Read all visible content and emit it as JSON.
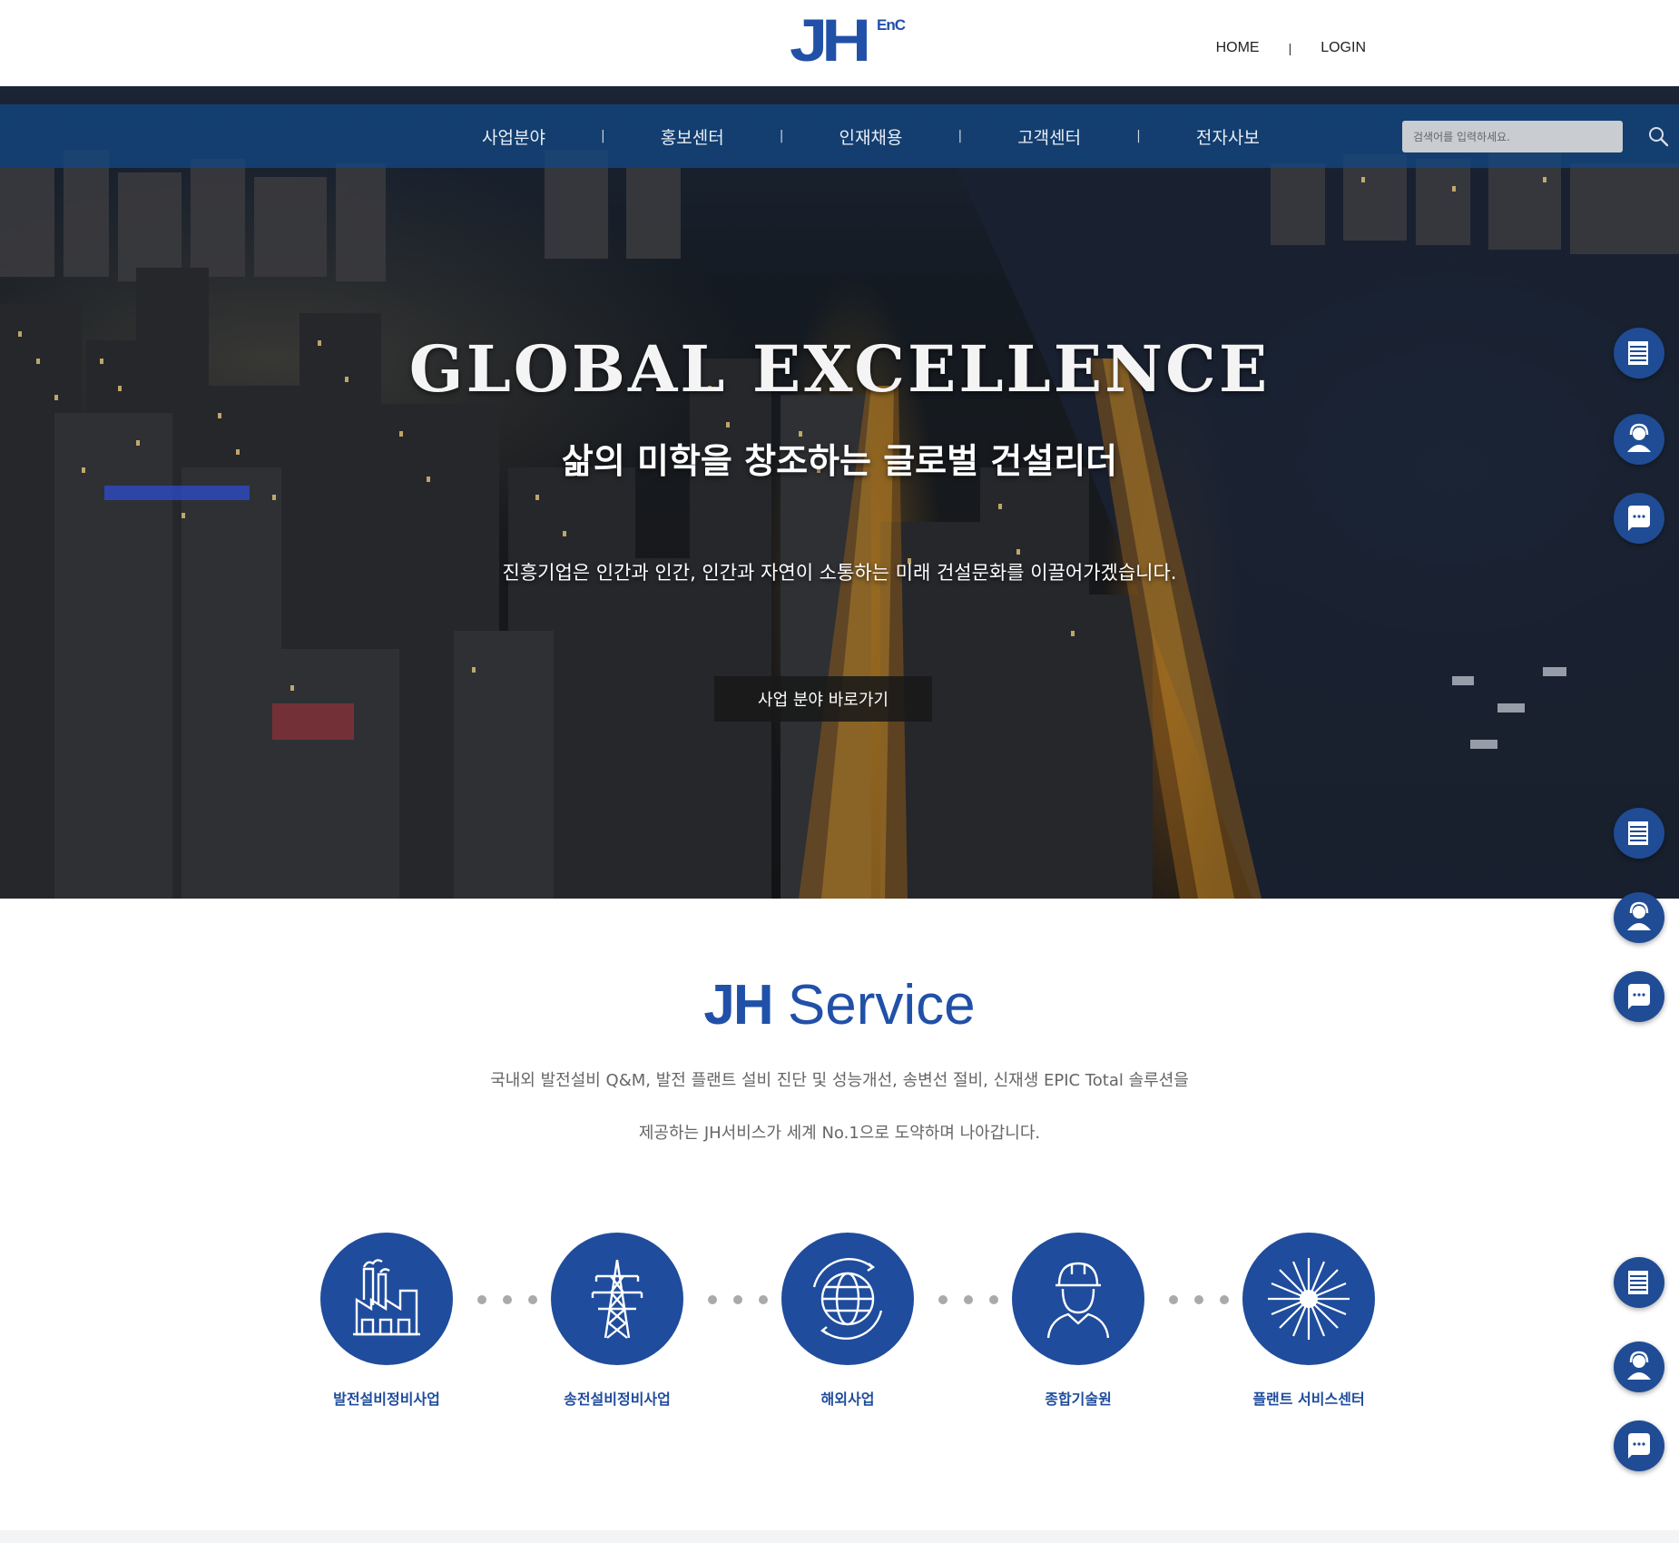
{
  "header": {
    "logo_main": "JH",
    "logo_sub": "EnC",
    "links": [
      "HOME",
      "LOGIN"
    ],
    "separator": "|"
  },
  "nav": {
    "items": [
      "사업분야",
      "홍보센터",
      "인재채용",
      "고객센터",
      "전자사보"
    ],
    "search_placeholder": "검색어를 입력하세요."
  },
  "hero": {
    "title": "GLOBAL EXCELLENCE",
    "subtitle": "삶의 미학을 창조하는 글로벌 건설리더",
    "description": "진흥기업은 인간과 인간, 인간과 자연이 소통하는 미래 건설문화를 이끌어가겠습니다.",
    "button": "사업 분야 바로가기"
  },
  "quick_buttons": [
    "document-icon",
    "counselor-icon",
    "chat-icon",
    "document-icon",
    "counselor-icon",
    "chat-icon",
    "document-icon",
    "counselor-icon",
    "chat-icon"
  ],
  "service": {
    "title_bold": "JH",
    "title_rest": " Service",
    "text_line1": "국내외 발전설비 Q&M, 발전 플랜트 설비 진단 및 성능개선, 송변선 절비, 신재생 EPIC Total 솔루션을",
    "text_line2": "제공하는 JH서비스가 세계 No.1으로 도약하며 나아갑니다.",
    "items": [
      {
        "label": "발전설비정비사업",
        "icon": "factory-icon"
      },
      {
        "label": "송전설비정비사업",
        "icon": "transmission-tower-icon"
      },
      {
        "label": "해외사업",
        "icon": "globe-icon"
      },
      {
        "label": "종합기술원",
        "icon": "engineer-icon"
      },
      {
        "label": "플랜트 서비스센터",
        "icon": "turbine-icon"
      }
    ]
  },
  "colors": {
    "brand_blue": "#2150a8",
    "nav_bar": "#124682",
    "service_circle": "#1f4c9c"
  }
}
